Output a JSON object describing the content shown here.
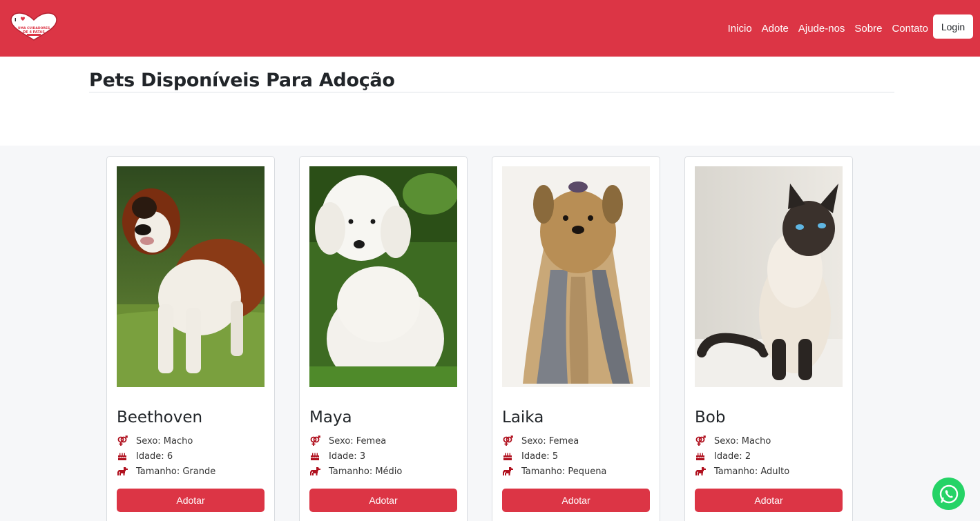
{
  "brand": {
    "logo_icon": "heart-logo-icon",
    "logo_text": "I ♥ UMA CUIDADORES DE 4 PATAS",
    "accent": "#dc3545"
  },
  "nav": {
    "items": [
      {
        "label": "Inicio"
      },
      {
        "label": "Adote"
      },
      {
        "label": "Ajude-nos"
      },
      {
        "label": "Sobre"
      },
      {
        "label": "Contato"
      }
    ],
    "login_label": "Login"
  },
  "page": {
    "title": "Pets Disponíveis Para Adoção"
  },
  "pets": [
    {
      "name": "Beethoven",
      "sexo": "Sexo: Macho",
      "idade": "Idade: 6",
      "tamanho": "Tamanho: Grande",
      "button": "Adotar",
      "photo": "saint-bernard-photo"
    },
    {
      "name": "Maya",
      "sexo": "Sexo: Femea",
      "idade": "Idade: 3",
      "tamanho": "Tamanho: Médio",
      "button": "Adotar",
      "photo": "poodle-photo"
    },
    {
      "name": "Laika",
      "sexo": "Sexo: Femea",
      "idade": "Idade: 5",
      "tamanho": "Tamanho: Pequena",
      "button": "Adotar",
      "photo": "yorkshire-photo"
    },
    {
      "name": "Bob",
      "sexo": "Sexo: Macho",
      "idade": "Idade: 2",
      "tamanho": "Tamanho: Adulto",
      "button": "Adotar",
      "photo": "siamese-cat-photo"
    }
  ],
  "icons": {
    "sex": "gender-icon",
    "age": "birthday-cake-icon",
    "size": "dog-icon",
    "chat": "whatsapp-icon"
  }
}
